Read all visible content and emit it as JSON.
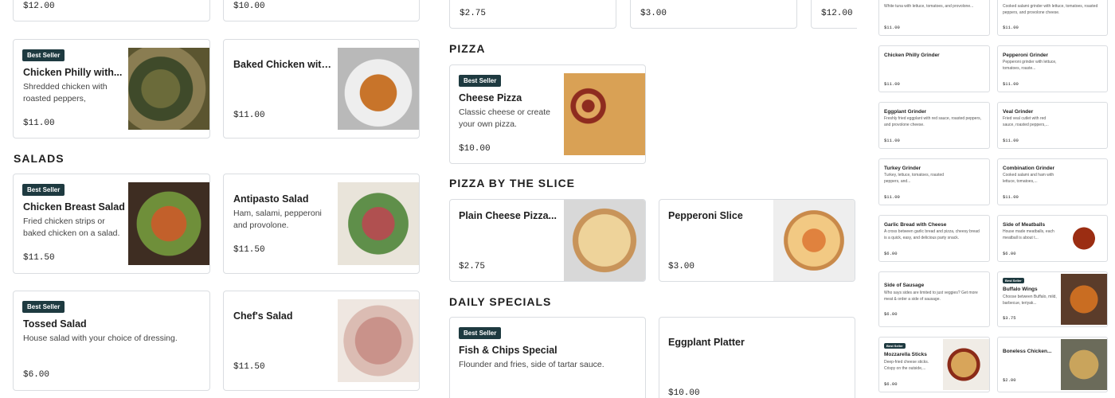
{
  "panel_a": {
    "top_prices": [
      "$12.00",
      "$10.00"
    ],
    "cards": [
      {
        "badge": "Best Seller",
        "title": "Chicken Philly with...",
        "desc": "Shredded chicken with roasted peppers, sautéed...",
        "price": "$11.00"
      },
      {
        "title": "Baked Chicken with...",
        "price": "$11.00"
      },
      {
        "badge": "Best Seller",
        "title": "Chicken Breast Salad",
        "desc": "Fried chicken strips or baked chicken on a salad.",
        "price": "$11.50"
      },
      {
        "title": "Antipasto Salad",
        "desc": "Ham, salami, pepperoni and provolone.",
        "price": "$11.50"
      },
      {
        "badge": "Best Seller",
        "title": "Tossed Salad",
        "desc": "House salad with your choice of dressing.",
        "price": "$6.00"
      },
      {
        "title": "Chef's Salad",
        "price": "$11.50"
      }
    ],
    "section_salads": "SALADS"
  },
  "panel_b": {
    "top_prices": [
      "$2.75",
      "$3.00",
      "$12.00"
    ],
    "section_pizza": "PIZZA",
    "section_slice": "PIZZA BY THE SLICE",
    "section_specials": "DAILY SPECIALS",
    "cards": [
      {
        "badge": "Best Seller",
        "title": "Cheese Pizza",
        "desc": "Classic cheese or create your own pizza.",
        "price": "$10.00"
      },
      {
        "title": "Plain Cheese Pizza...",
        "price": "$2.75"
      },
      {
        "title": "Pepperoni Slice",
        "price": "$3.00"
      },
      {
        "badge": "Best Seller",
        "title": "Fish & Chips Special",
        "desc": "Flounder and fries, side of tartar sauce."
      },
      {
        "title": "Eggplant Platter",
        "price": "$10.00"
      }
    ]
  },
  "panel_c": {
    "cards": [
      {
        "desc": "White tuna with lettuce, tomatoes, and provolone...",
        "price": "$11.00"
      },
      {
        "desc": "Cooked salami grinder with lettuce, tomatoes, roasted peppers, and provolone cheese.",
        "price": "$11.00"
      },
      {
        "title": "Chicken Philly Grinder",
        "price": "$11.00"
      },
      {
        "title": "Pepperoni Grinder",
        "desc": "Pepperoni grinder with lettuce, tomatoes, roaste...",
        "price": "$11.00"
      },
      {
        "title": "Eggplant Grinder",
        "desc": "Freshly fried eggplant with red sauce, roasted peppers, and provolone cheese.",
        "price": "$11.00"
      },
      {
        "title": "Veal Grinder",
        "desc": "Fried veal cutlet with red sauce, roasted peppers,...",
        "price": "$11.00"
      },
      {
        "title": "Turkey Grinder",
        "desc": "Turkey, lettuce, tomatoes, roasted peppers, and...",
        "price": "$11.00"
      },
      {
        "title": "Combination Grinder",
        "desc": "Cooked salami and ham with lettuce, tomatoes,...",
        "price": "$11.00"
      },
      {
        "title": "Garlic Bread with Cheese",
        "desc": "A cross between garlic bread and pizza, cheesy bread is a quick, easy, and delicious party snack.",
        "price": "$6.00"
      },
      {
        "title": "Side of Meatballs",
        "desc": "House made meatballs, each meatball is about t...",
        "price": "$6.00"
      },
      {
        "title": "Side of Sausage",
        "desc": "Who says sides are limited to just veggies? Get more meat & order a side of sausage.",
        "price": "$6.00"
      },
      {
        "badge": "Best Seller",
        "title": "Buffalo Wings",
        "desc": "Choose between Buffalo, mild, barbecue, teriyak...",
        "price": "$3.75"
      },
      {
        "badge": "Best Seller",
        "title": "Mozzarella Sticks",
        "desc": "Deep-fried cheese sticks. Crispy on the outside,...",
        "price": "$6.00"
      },
      {
        "title": "Boneless Chicken...",
        "price": "$2.00"
      }
    ]
  }
}
